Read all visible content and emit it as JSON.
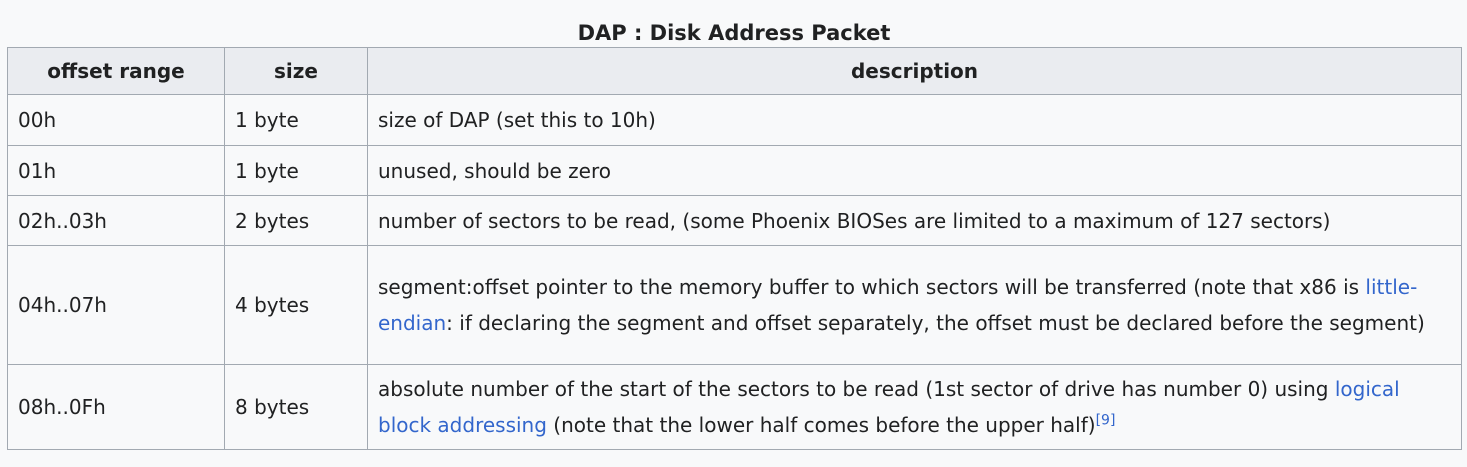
{
  "caption": "DAP : Disk Address Packet",
  "headers": {
    "offset": "offset range",
    "size": "size",
    "description": "description"
  },
  "rows": [
    {
      "offset": "00h",
      "size": "1 byte",
      "description": "size of DAP (set this to 10h)"
    },
    {
      "offset": "01h",
      "size": "1 byte",
      "description": "unused, should be zero"
    },
    {
      "offset": "02h..03h",
      "size": "2 bytes",
      "description": "number of sectors to be read, (some Phoenix BIOSes are limited to a maximum of 127 sectors)"
    },
    {
      "offset": "04h..07h",
      "size": "4 bytes",
      "desc_before": "segment:offset pointer to the memory buffer to which sectors will be transferred (note that x86 is ",
      "link": "little-endian",
      "desc_after": ": if declaring the segment and offset separately, the offset must be declared before the segment)"
    },
    {
      "offset": "08h..0Fh",
      "size": "8 bytes",
      "desc_before": "absolute number of the start of the sectors to be read (1st sector of drive has number 0) using ",
      "link": "logical block addressing",
      "desc_after": " (note that the lower half comes before the upper half)",
      "ref": "[9]"
    }
  ],
  "colors": {
    "link": "#3366cc",
    "header_bg": "#eaecf0",
    "border": "#a2a9b1",
    "background": "#f8f9fa"
  }
}
